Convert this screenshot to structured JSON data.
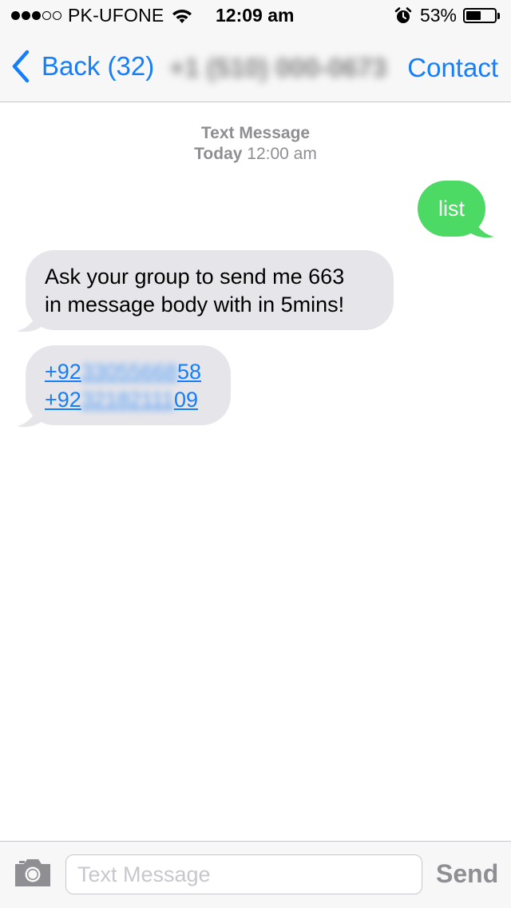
{
  "status_bar": {
    "signal_dots_filled": 3,
    "signal_dots_total": 5,
    "carrier": "PK-UFONE",
    "time": "12:09 am",
    "battery_text": "53%",
    "battery_level": 0.53
  },
  "nav": {
    "back_label": "Back (32)",
    "contact_name": "+1 (510) 000-0673",
    "contact_button": "Contact"
  },
  "thread": {
    "service": "Text Message",
    "day": "Today",
    "time": "12:00 am"
  },
  "messages": {
    "sent": "list",
    "received_line1": "Ask your group to send me 663",
    "received_line2": "in message body with in 5mins!",
    "phone1_start": "+92",
    "phone1_hidden": "33055668",
    "phone1_end": "58",
    "phone2_start": "+92",
    "phone2_hidden": "32182111",
    "phone2_end": "09"
  },
  "input": {
    "placeholder": "Text Message",
    "send_label": "Send"
  },
  "colors": {
    "ios_blue": "#147efb",
    "sent_bubble": "#4cd964",
    "received_bubble": "#e5e5ea"
  }
}
